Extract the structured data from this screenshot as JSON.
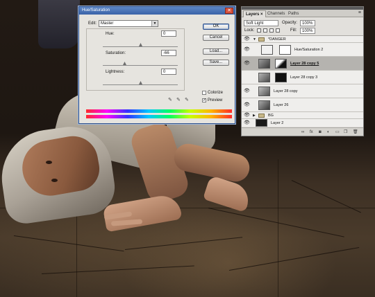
{
  "hue_saturation_dialog": {
    "title": "Hue/Saturation",
    "close_glyph": "✕",
    "edit_label": "Edit:",
    "edit_value": "Master",
    "hue_label": "Hue:",
    "hue_value": "0",
    "saturation_label": "Saturation:",
    "saturation_value": "-66",
    "lightness_label": "Lightness:",
    "lightness_value": "0",
    "buttons": {
      "ok": "OK",
      "cancel": "Cancel",
      "load": "Load...",
      "save": "Save..."
    },
    "colorize_label": "Colorize",
    "colorize_checked": false,
    "preview_label": "Preview",
    "preview_checked": true
  },
  "layers_panel": {
    "tabs": [
      "Layers ×",
      "Channels",
      "Paths"
    ],
    "menu_glyph": "≡",
    "blend_mode": "Soft Light",
    "opacity_label": "Opacity:",
    "opacity_value": "100%",
    "lock_label": "Lock:",
    "fill_label": "Fill:",
    "fill_value": "100%",
    "layers": [
      {
        "name": "*DANGER",
        "type": "group",
        "visible": true,
        "expanded": true
      },
      {
        "name": "Hue/Saturation 2",
        "type": "adjustment",
        "visible": true
      },
      {
        "name": "Layer 28 copy 5",
        "type": "layer",
        "visible": true,
        "selected": true
      },
      {
        "name": "Layer 28 copy 3",
        "type": "layer",
        "visible": false
      },
      {
        "name": "Layer 28 copy",
        "type": "layer",
        "visible": true
      },
      {
        "name": "Layer 26",
        "type": "layer",
        "visible": true
      },
      {
        "name": "BG",
        "type": "group",
        "visible": true,
        "expanded": false
      },
      {
        "name": "Layer 2",
        "type": "layer",
        "visible": true
      }
    ],
    "bottom_icons": [
      "link-icon",
      "fx-icon",
      "mask-icon",
      "adjustment-icon",
      "group-icon",
      "new-layer-icon",
      "trash-icon"
    ]
  }
}
